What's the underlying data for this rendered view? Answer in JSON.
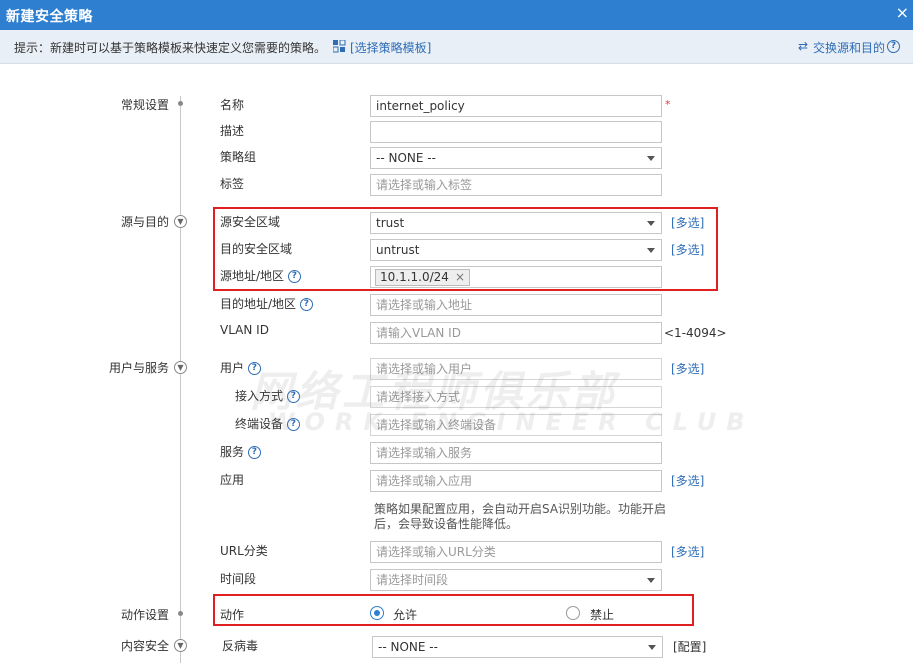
{
  "window": {
    "title": "新建安全策略",
    "close_glyph": "×"
  },
  "tip": {
    "text": "提示：新建时可以基于策略模板来快速定义您需要的策略。",
    "template_link": "[选择策略模板]",
    "swap_link": "交换源和目的",
    "swap_glyph": "⇄",
    "help_glyph": "?"
  },
  "sections": {
    "general": "常规设置",
    "src_dst": "源与目的",
    "user_service": "用户与服务",
    "action": "动作设置",
    "content": "内容安全"
  },
  "general": {
    "name_label": "名称",
    "name_value": "internet_policy",
    "required_mark": "*",
    "desc_label": "描述",
    "desc_value": "",
    "group_label": "策略组",
    "group_value": "-- NONE --",
    "tag_label": "标签",
    "tag_placeholder": "请选择或输入标签"
  },
  "src_dst": {
    "src_zone_label": "源安全区域",
    "src_zone_value": "trust",
    "dst_zone_label": "目的安全区域",
    "dst_zone_value": "untrust",
    "multi_select": "[多选]",
    "src_addr_label": "源地址/地区",
    "src_addr_tag": "10.1.1.0/24",
    "tag_remove": "×",
    "dst_addr_label": "目的地址/地区",
    "dst_addr_placeholder": "请选择或输入地址",
    "vlan_label": "VLAN ID",
    "vlan_placeholder": "请输入VLAN ID",
    "vlan_range": "<1-4094>"
  },
  "user_service": {
    "user_label": "用户",
    "user_placeholder": "请选择或输入用户",
    "access_label": "接入方式",
    "access_placeholder": "请选择接入方式",
    "terminal_label": "终端设备",
    "terminal_placeholder": "请选择或输入终端设备",
    "service_label": "服务",
    "service_placeholder": "请选择或输入服务",
    "app_label": "应用",
    "app_placeholder": "请选择或输入应用",
    "app_note": "策略如果配置应用，会自动开启SA识别功能。功能开启后，会导致设备性能降低。",
    "url_label": "URL分类",
    "url_placeholder": "请选择或输入URL分类",
    "time_label": "时间段",
    "time_placeholder": "请选择时间段"
  },
  "action": {
    "label": "动作",
    "permit": "允许",
    "deny": "禁止",
    "selected": "permit"
  },
  "content": {
    "antivirus_label": "反病毒",
    "antivirus_value": "-- NONE --",
    "config_link": "[配置]"
  },
  "watermark": {
    "line1": "网络工程师俱乐部",
    "line2": "WORK ENGINEER CLUB"
  },
  "colors": {
    "titlebar": "#2e7fd0",
    "link": "#2e6db5",
    "highlight": "#e02020",
    "tipbar": "#e9eff6"
  }
}
